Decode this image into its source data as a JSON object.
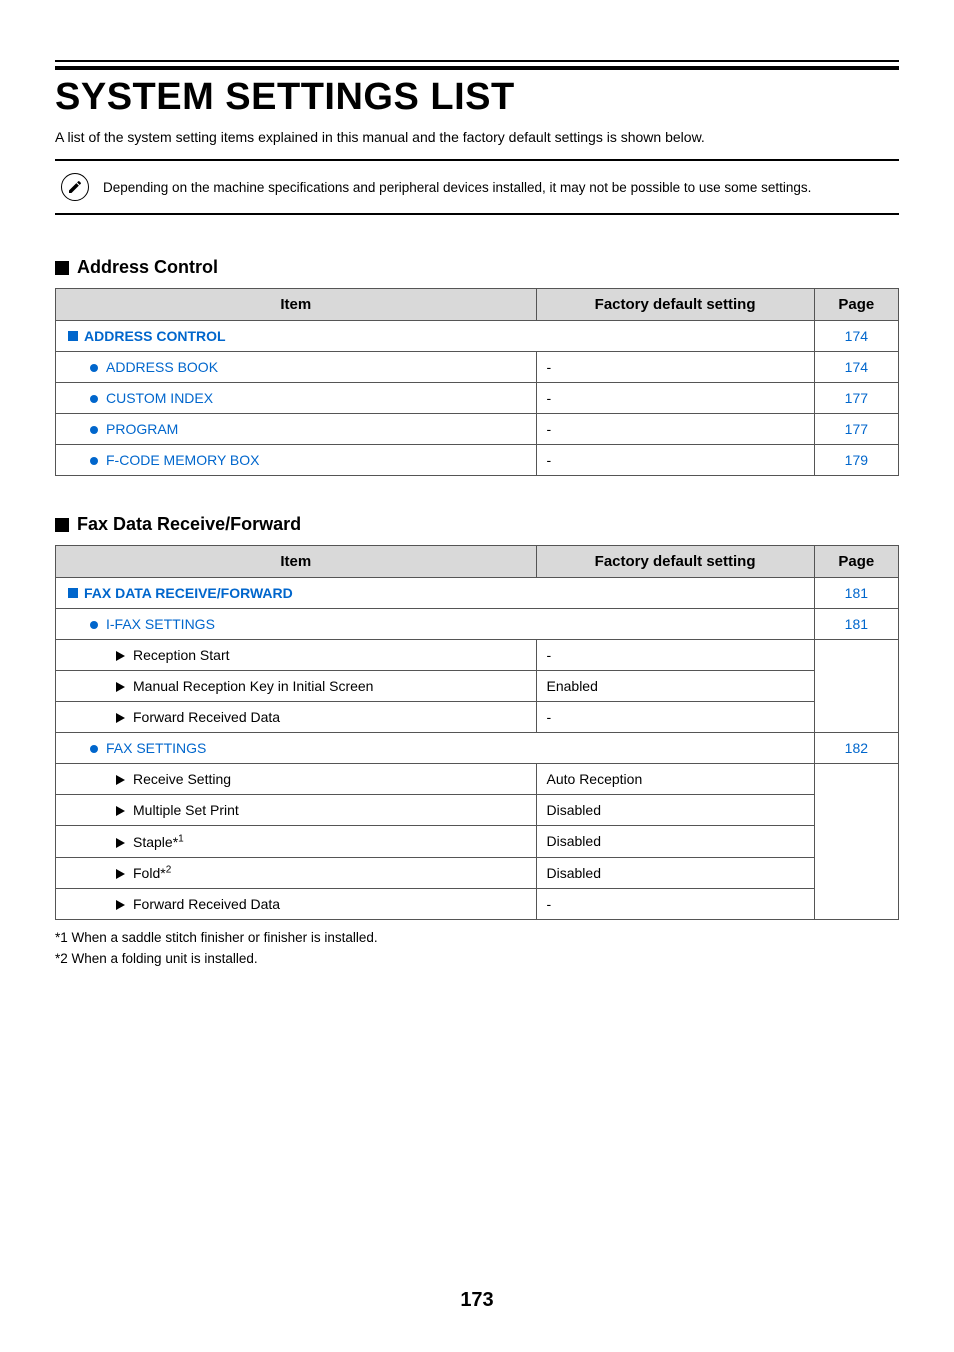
{
  "title": "SYSTEM SETTINGS LIST",
  "intro": "A list of the system setting items explained in this manual and the factory default settings is shown below.",
  "note": "Depending on the machine specifications and peripheral devices installed, it may not be possible to use some settings.",
  "columns": {
    "item": "Item",
    "factory": "Factory default setting",
    "page": "Page"
  },
  "section1": {
    "heading": "Address Control",
    "rows": [
      {
        "item": "ADDRESS CONTROL",
        "factory": "",
        "page": "174",
        "link": true,
        "marker": "sq",
        "spanItem": true,
        "indent": 1,
        "bold": true
      },
      {
        "item": "ADDRESS BOOK",
        "factory": "-",
        "page": "174",
        "link": true,
        "marker": "bullet",
        "indent": 2
      },
      {
        "item": "CUSTOM INDEX",
        "factory": "-",
        "page": "177",
        "link": true,
        "marker": "bullet",
        "indent": 2
      },
      {
        "item": "PROGRAM",
        "factory": "-",
        "page": "177",
        "link": true,
        "marker": "bullet",
        "indent": 2
      },
      {
        "item": "F-CODE MEMORY BOX",
        "factory": "-",
        "page": "179",
        "link": true,
        "marker": "bullet",
        "indent": 2
      }
    ]
  },
  "section2": {
    "heading": "Fax Data Receive/Forward",
    "rows": [
      {
        "item": "FAX DATA RECEIVE/FORWARD",
        "factory": "",
        "page": "181",
        "link": true,
        "marker": "sq",
        "spanItem": true,
        "indent": 1,
        "bold": true
      },
      {
        "item": "I-FAX SETTINGS",
        "factory": "",
        "page": "181",
        "link": true,
        "marker": "bullet",
        "spanItem": true,
        "indent": 2
      },
      {
        "item": "Reception Start",
        "factory": "-",
        "page": "",
        "marker": "tri",
        "indent": 3,
        "pageRowspanStart": 3
      },
      {
        "item": "Manual Reception Key in Initial Screen",
        "factory": "Enabled",
        "page": "",
        "marker": "tri",
        "indent": 3,
        "pageSkipped": true
      },
      {
        "item": "Forward Received Data",
        "factory": "-",
        "page": "",
        "marker": "tri",
        "indent": 3,
        "pageSkipped": true
      },
      {
        "item": "FAX SETTINGS",
        "factory": "",
        "page": "182",
        "link": true,
        "marker": "bullet",
        "spanItem": true,
        "indent": 2
      },
      {
        "item": "Receive Setting",
        "factory": "Auto Reception",
        "page": "",
        "marker": "tri",
        "indent": 3,
        "pageRowspanStart": 5
      },
      {
        "item": "Multiple Set Print",
        "factory": "Disabled",
        "page": "",
        "marker": "tri",
        "indent": 3,
        "pageSkipped": true
      },
      {
        "item": "Staple*",
        "sup": "1",
        "factory": "Disabled",
        "page": "",
        "marker": "tri",
        "indent": 3,
        "pageSkipped": true
      },
      {
        "item": "Fold*",
        "sup": "2",
        "factory": "Disabled",
        "page": "",
        "marker": "tri",
        "indent": 3,
        "pageSkipped": true
      },
      {
        "item": "Forward Received Data",
        "factory": "-",
        "page": "",
        "marker": "tri",
        "indent": 3,
        "pageSkipped": true
      }
    ]
  },
  "footnotes": [
    "*1  When a saddle stitch finisher or finisher is installed.",
    "*2  When a folding unit is installed."
  ],
  "pageNumber": "173"
}
